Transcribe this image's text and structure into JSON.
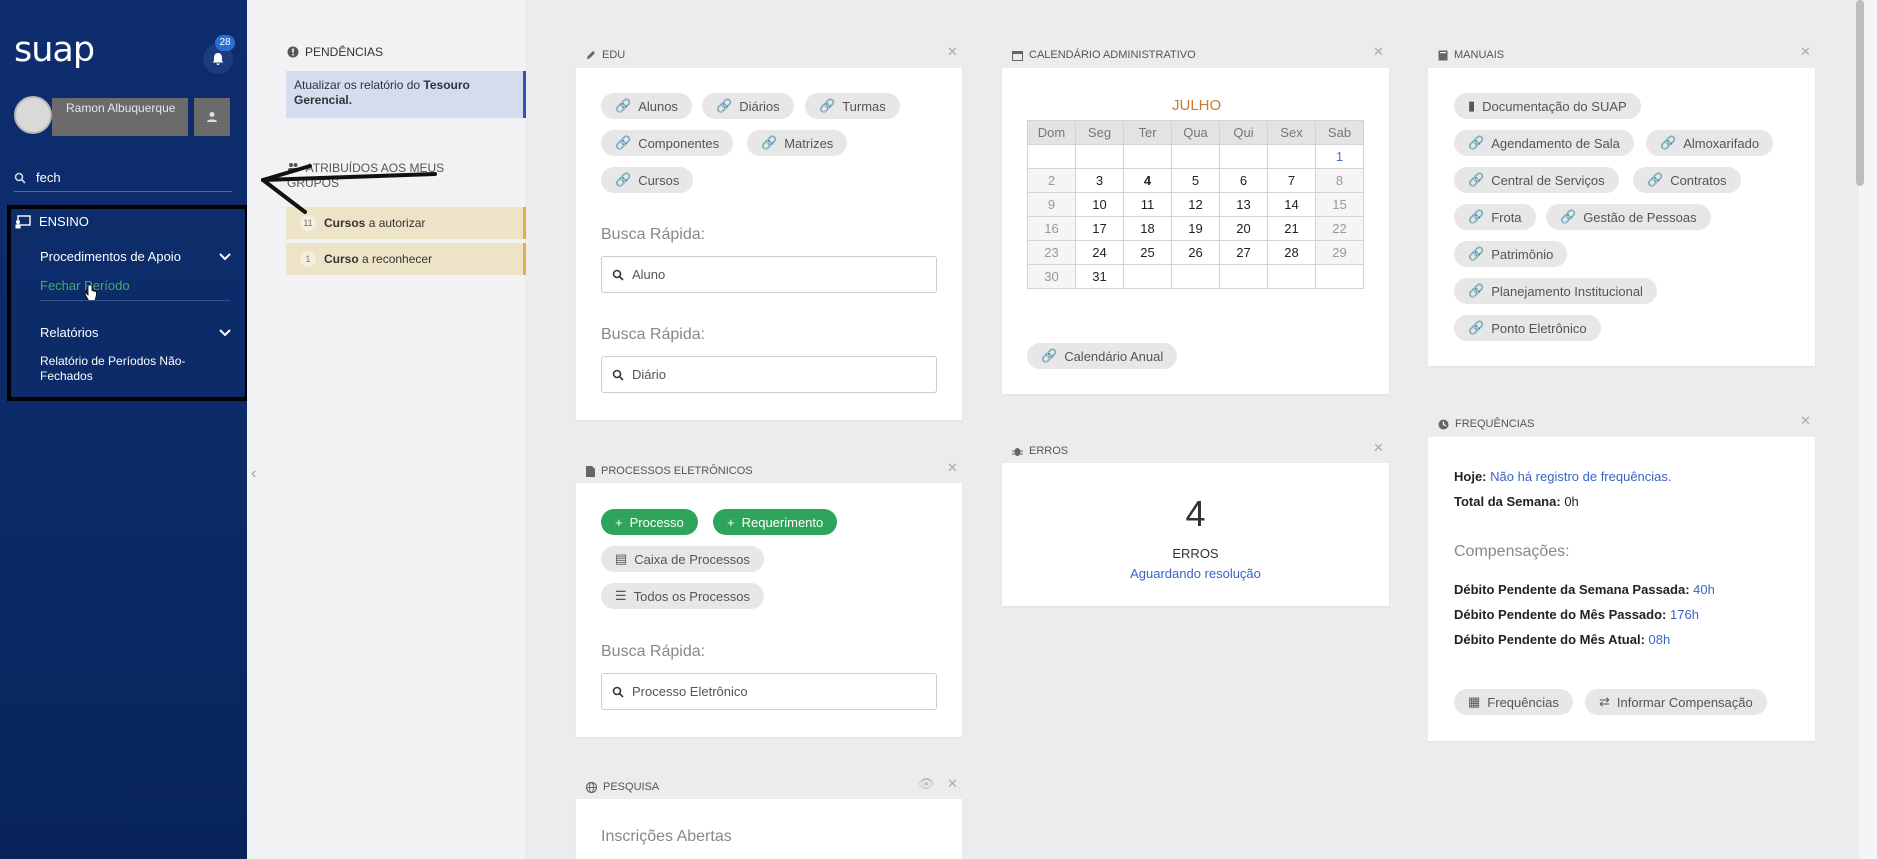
{
  "sidebar": {
    "logo": "suap",
    "notifications_count": "28",
    "user_name": "Ramon Albuquerque",
    "search_value": "fech",
    "section": "ENSINO",
    "groups": [
      {
        "label": "Procedimentos de Apoio",
        "items": [
          "Fechar Período"
        ]
      },
      {
        "label": "Relatórios",
        "items": [
          "Relatório de Períodos Não-Fechados"
        ]
      }
    ]
  },
  "pendencias": {
    "title": "PENDÊNCIAS",
    "message_prefix": "Atualizar os relatório do ",
    "message_bold": "Tesouro Gerencial."
  },
  "atribuidos": {
    "title": "ATRIBUÍDOS AOS MEUS GRUPOS",
    "tasks": [
      {
        "count": "11",
        "bold": "Cursos",
        "text": "a autorizar"
      },
      {
        "count": "1",
        "bold": "Curso",
        "text": "a reconhecer"
      }
    ]
  },
  "edu": {
    "title": "EDU",
    "links": [
      "Alunos",
      "Diários",
      "Turmas",
      "Componentes",
      "Matrizes",
      "Cursos"
    ],
    "busca_label_1": "Busca Rápida:",
    "busca_placeholder_1": "Aluno",
    "busca_label_2": "Busca Rápida:",
    "busca_placeholder_2": "Diário"
  },
  "processos": {
    "title": "PROCESSOS ELETRÔNICOS",
    "btn_processo": "Processo",
    "btn_requerimento": "Requerimento",
    "caixa": "Caixa de Processos",
    "todos": "Todos os Processos",
    "busca_label": "Busca Rápida:",
    "busca_placeholder": "Processo Eletrônico"
  },
  "pesquisa": {
    "title": "PESQUISA",
    "subtitle": "Inscrições Abertas"
  },
  "calendario": {
    "title": "CALENDÁRIO ADMINISTRATIVO",
    "month": "JULHO",
    "weekdays": [
      "Dom",
      "Seg",
      "Ter",
      "Qua",
      "Qui",
      "Sex",
      "Sab"
    ],
    "weeks": [
      [
        "",
        "",
        "",
        "",
        "",
        "",
        "1"
      ],
      [
        "2",
        "3",
        "4",
        "5",
        "6",
        "7",
        "8"
      ],
      [
        "9",
        "10",
        "11",
        "12",
        "13",
        "14",
        "15"
      ],
      [
        "16",
        "17",
        "18",
        "19",
        "20",
        "21",
        "22"
      ],
      [
        "23",
        "24",
        "25",
        "26",
        "27",
        "28",
        "29"
      ],
      [
        "30",
        "31",
        "",
        "",
        "",
        "",
        ""
      ]
    ],
    "today": "4",
    "annual_link": "Calendário Anual"
  },
  "erros": {
    "title": "ERROS",
    "count": "4",
    "label": "ERROS",
    "status": "Aguardando resolução"
  },
  "manuais": {
    "title": "MANUAIS",
    "doc": "Documentação do SUAP",
    "links": [
      "Agendamento de Sala",
      "Almoxarifado",
      "Central de Serviços",
      "Contratos",
      "Frota",
      "Gestão de Pessoas",
      "Patrimônio",
      "Planejamento Institucional",
      "Ponto Eletrônico"
    ]
  },
  "frequencias": {
    "title": "FREQUÊNCIAS",
    "hoje_label": "Hoje:",
    "hoje_value": "Não há registro de frequências.",
    "semana_label": "Total da Semana:",
    "semana_value": "0h",
    "compensacoes": "Compensações:",
    "deb_semana_label": "Débito Pendente da Semana Passada:",
    "deb_semana_value": "40h",
    "deb_mes_pass_label": "Débito Pendente do Mês Passado:",
    "deb_mes_pass_value": "176h",
    "deb_mes_atual_label": "Débito Pendente do Mês Atual:",
    "deb_mes_atual_value": "08h",
    "btn_frequencias": "Frequências",
    "btn_compensacao": "Informar Compensação"
  },
  "colors": {
    "sidebar": "#0e2d6e",
    "accent_blue": "#3a62c8",
    "green": "#2ea55a",
    "pending_bg": "#d6dcf0",
    "task_bg": "#ede4c7"
  }
}
